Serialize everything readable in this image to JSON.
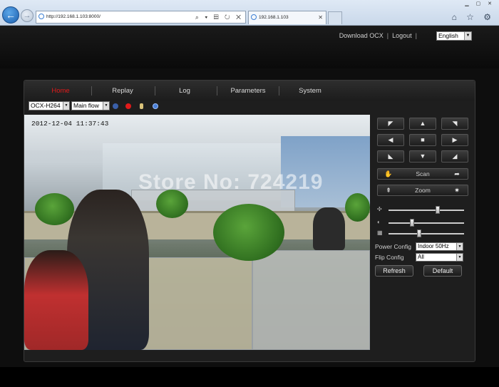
{
  "browser": {
    "address": "http://192.168.1.103:8000/",
    "tab_title": "192.168.1.103",
    "address_tools": "⌕ ▾ ▤ ↻ ✕",
    "window_controls": "▁ ▢ ✕",
    "chrome_icons": "⌂ ☆ ⚙"
  },
  "header": {
    "download_ocx": "Download OCX",
    "separator": "|",
    "logout": "Logout",
    "language": "English"
  },
  "menu": {
    "items": [
      {
        "label": "Home",
        "active": true
      },
      {
        "label": "Replay"
      },
      {
        "label": "Log"
      },
      {
        "label": "Parameters"
      },
      {
        "label": "System"
      }
    ]
  },
  "toolbar": {
    "codec": "OCX-H264",
    "stream": "Main flow",
    "record_color": "#e01a1a"
  },
  "video": {
    "timestamp": "2012-12-04  11:37:43",
    "watermark": "Store No: 724219"
  },
  "ptz": {
    "arrows": {
      "up_left": "◤",
      "up": "▲",
      "up_right": "◥",
      "left": "◀",
      "center": "■",
      "right": "▶",
      "down_left": "◣",
      "down": "▼",
      "down_right": "◢"
    },
    "scan_label": "Scan",
    "zoom_label": "Zoom"
  },
  "image_adjust": {
    "brightness_level": 0.66,
    "contrast_level": 0.3,
    "saturation_level": 0.4
  },
  "config": {
    "power_label": "Power Config",
    "power_value": "Indoor 50Hz",
    "flip_label": "Flip Config",
    "flip_value": "All",
    "refresh_label": "Refresh",
    "default_label": "Default"
  }
}
